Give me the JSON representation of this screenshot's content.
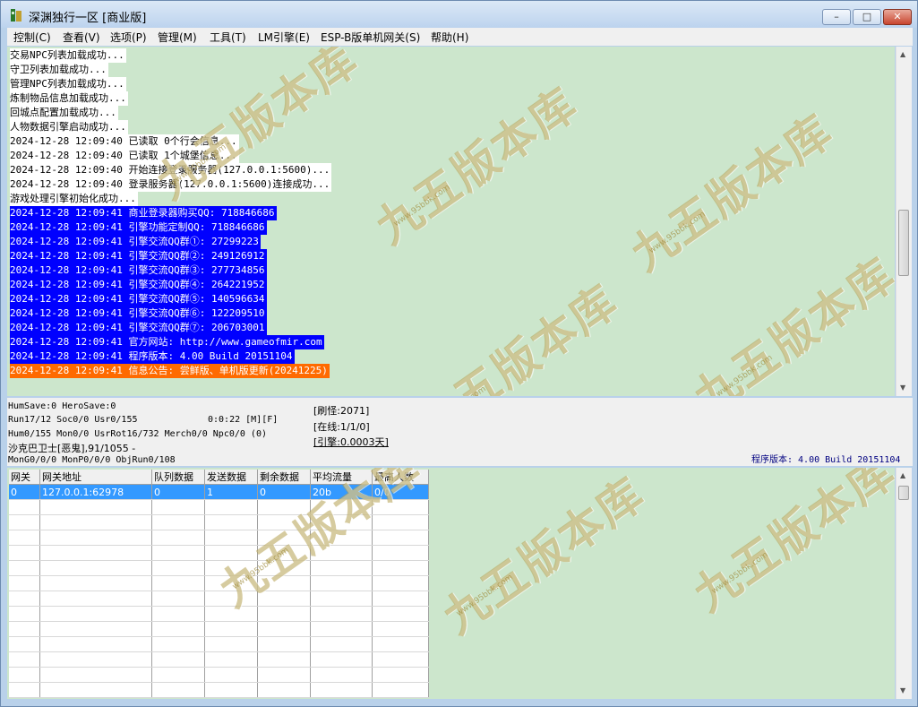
{
  "window": {
    "title": "深渊独行一区 [商业版]",
    "minimize": "–",
    "maximize": "□",
    "close": "✕"
  },
  "menu": [
    "控制(C)",
    "查看(V)",
    "选项(P)",
    "管理(M)",
    "工具(T)",
    "LM引擎(E)",
    "ESP-B版单机网关(S)",
    "帮助(H)"
  ],
  "log": [
    {
      "text": "交易NPC列表加载成功...",
      "style": "white"
    },
    {
      "text": "守卫列表加载成功...",
      "style": "white"
    },
    {
      "text": "管理NPC列表加载成功...",
      "style": "white"
    },
    {
      "text": "炼制物品信息加载成功...",
      "style": "white"
    },
    {
      "text": "回城点配置加载成功...",
      "style": "white"
    },
    {
      "text": "人物数据引擎启动成功...",
      "style": "white"
    },
    {
      "text": "2024-12-28 12:09:40 已读取 0个行会信息...",
      "style": "white"
    },
    {
      "text": "2024-12-28 12:09:40 已读取 1个城堡信息...",
      "style": "white"
    },
    {
      "text": "2024-12-28 12:09:40 开始连接登录服务器(127.0.0.1:5600)...",
      "style": "white"
    },
    {
      "text": "2024-12-28 12:09:40 登录服务器(127.0.0.1:5600)连接成功...",
      "style": "white"
    },
    {
      "text": "游戏处理引擎初始化成功...",
      "style": "white"
    },
    {
      "text": "2024-12-28 12:09:41 商业登录器购买QQ: 718846686",
      "style": "blue"
    },
    {
      "text": "2024-12-28 12:09:41 引擎功能定制QQ: 718846686",
      "style": "blue"
    },
    {
      "text": "2024-12-28 12:09:41 引擎交流QQ群①: 27299223",
      "style": "blue"
    },
    {
      "text": "2024-12-28 12:09:41 引擎交流QQ群②: 249126912",
      "style": "blue"
    },
    {
      "text": "2024-12-28 12:09:41 引擎交流QQ群③: 277734856",
      "style": "blue"
    },
    {
      "text": "2024-12-28 12:09:41 引擎交流QQ群④: 264221952",
      "style": "blue"
    },
    {
      "text": "2024-12-28 12:09:41 引擎交流QQ群⑤: 140596634",
      "style": "blue"
    },
    {
      "text": "2024-12-28 12:09:41 引擎交流QQ群⑥: 122209510",
      "style": "blue"
    },
    {
      "text": "2024-12-28 12:09:41 引擎交流QQ群⑦: 206703001",
      "style": "blue"
    },
    {
      "text": "2024-12-28 12:09:41 官方网站: http://www.gameofmir.com",
      "style": "blue"
    },
    {
      "text": "2024-12-28 12:09:41 程序版本: 4.00 Build 20151104",
      "style": "blue"
    },
    {
      "text": "2024-12-28 12:09:41 信息公告: 尝鲜版、单机版更新(20241225)",
      "style": "orange"
    }
  ],
  "status": {
    "humsave": "HumSave:0 HeroSave:0",
    "run": "Run17/12 Soc0/0 Usr0/155",
    "time": "0:0:22 [M][F]",
    "hum": "Hum0/155 Mon0/0 UsrRot16/732 Merch0/0 Npc0/0 (0)",
    "guard": "沙克巴卫士[恶鬼],91/1055 -",
    "mongo": "MonG0/0/0 MonP0/0/0 ObjRun0/108",
    "refresh": "[刷怪:2071]",
    "online": "[在线:1/1/0]",
    "engine": "[引擎:0.0003天]",
    "version": "程序版本: 4.00 Build 20151104"
  },
  "gateway_table": {
    "headers": [
      "网关",
      "网关地址",
      "队列数据",
      "发送数据",
      "剩余数据",
      "平均流量",
      "最高人数"
    ],
    "rows": [
      [
        "0",
        "127.0.0.1:62978",
        "0",
        "1",
        "0",
        "20b",
        "0/0"
      ]
    ]
  },
  "watermark": {
    "text": "九五版本库",
    "url": "www.95bbk.com"
  }
}
